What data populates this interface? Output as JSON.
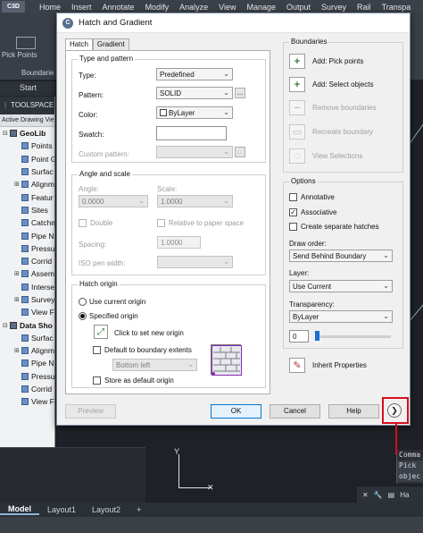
{
  "app": {
    "badge": "C3D"
  },
  "menu": [
    "Home",
    "Insert",
    "Annotate",
    "Modify",
    "Analyze",
    "View",
    "Manage",
    "Output",
    "Survey",
    "Rail",
    "Transpa"
  ],
  "ribbon": {
    "button_label": "Pick Points",
    "panel_label": "Boundarie"
  },
  "start_tab": "Start",
  "toolspace": {
    "title": "TOOLSPACE",
    "tab": "Active Drawing Vie",
    "items": [
      {
        "label": "GeoLib",
        "exp": "⊟"
      },
      {
        "label": "Points",
        "exp": ""
      },
      {
        "label": "Point G",
        "exp": ""
      },
      {
        "label": "Surfac",
        "exp": ""
      },
      {
        "label": "Alignm",
        "exp": "⊞"
      },
      {
        "label": "Featur",
        "exp": ""
      },
      {
        "label": "Sites",
        "exp": ""
      },
      {
        "label": "Catchm",
        "exp": ""
      },
      {
        "label": "Pipe N",
        "exp": ""
      },
      {
        "label": "Pressu",
        "exp": ""
      },
      {
        "label": "Corrid",
        "exp": ""
      },
      {
        "label": "Assem",
        "exp": "⊞"
      },
      {
        "label": "Interse",
        "exp": ""
      },
      {
        "label": "Survey",
        "exp": "⊞"
      },
      {
        "label": "View F",
        "exp": ""
      },
      {
        "label": "Data Sho",
        "exp": "⊟"
      },
      {
        "label": "Surfac",
        "exp": ""
      },
      {
        "label": "Alignm",
        "exp": "⊞"
      },
      {
        "label": "Pipe N",
        "exp": ""
      },
      {
        "label": "Pressu",
        "exp": ""
      },
      {
        "label": "Corrid",
        "exp": ""
      },
      {
        "label": "View F",
        "exp": ""
      }
    ]
  },
  "dialog": {
    "title": "Hatch and Gradient",
    "tabs": [
      "Hatch",
      "Gradient"
    ],
    "type_pattern": {
      "title": "Type and pattern",
      "type_label": "Type:",
      "type_value": "Predefined",
      "pattern_label": "Pattern:",
      "pattern_value": "SOLID",
      "color_label": "Color:",
      "color_value": "ByLayer",
      "swatch_label": "Swatch:",
      "custom_label": "Custom pattern:",
      "dots": "..."
    },
    "angle_scale": {
      "title": "Angle and scale",
      "angle_label": "Angle:",
      "angle_value": "0.0000",
      "scale_label": "Scale:",
      "scale_value": "1.0000",
      "double_label": "Double",
      "relative_label": "Relative to paper space",
      "spacing_label": "Spacing:",
      "spacing_value": "1.0000",
      "iso_label": "ISO pen width:"
    },
    "origin": {
      "title": "Hatch origin",
      "use_current": "Use current origin",
      "specified": "Specified origin",
      "click_set": "Click to set new origin",
      "default_extents": "Default to boundary extents",
      "extent_value": "Bottom left",
      "store_default": "Store as default origin"
    },
    "boundaries": {
      "title": "Boundaries",
      "items": [
        {
          "label": "Add: Pick points",
          "icon": "+"
        },
        {
          "label": "Add: Select objects",
          "icon": "+"
        },
        {
          "label": "Remove boundaries",
          "icon": "−"
        },
        {
          "label": "Recreate boundary",
          "icon": "▭"
        },
        {
          "label": "View Selections",
          "icon": "◌"
        }
      ]
    },
    "options": {
      "title": "Options",
      "annotative": "Annotative",
      "associative": "Associative",
      "separate": "Create separate hatches",
      "draw_order_label": "Draw order:",
      "draw_order_value": "Send Behind Boundary",
      "layer_label": "Layer:",
      "layer_value": "Use Current",
      "transparency_label": "Transparency:",
      "transparency_value": "ByLayer",
      "transparency_number": "0",
      "transparency_level": 0
    },
    "inherit_label": "Inherit Properties",
    "buttons": {
      "preview": "Preview",
      "ok": "OK",
      "cancel": "Cancel",
      "help": "Help"
    },
    "expand_glyph": "❯"
  },
  "command": {
    "lines": [
      "Comma",
      "Pick",
      "objec"
    ],
    "input_label": "Ha"
  },
  "layout_tabs": [
    "Model",
    "Layout1",
    "Layout2",
    "+"
  ]
}
